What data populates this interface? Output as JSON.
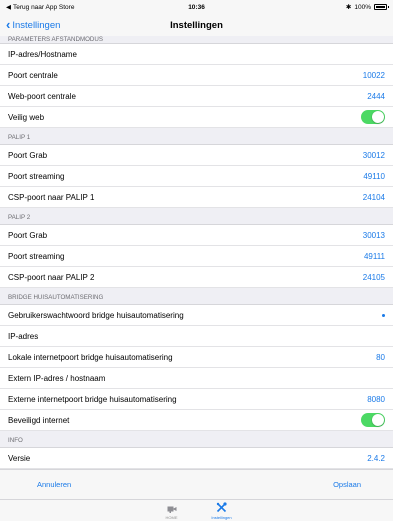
{
  "status_bar": {
    "back_app": "Terug naar App Store",
    "time": "10:36",
    "battery": "100%"
  },
  "nav": {
    "back_label": "Instellingen",
    "title": "Instellingen"
  },
  "sections": {
    "remote": {
      "header": "PARAMETERS AFSTANDMODUS",
      "ip_label": "IP-adres/Hostname",
      "port_label": "Poort centrale",
      "port_value": "10022",
      "webport_label": "Web-poort centrale",
      "webport_value": "2444",
      "secure_label": "Veilig web"
    },
    "palip1": {
      "header": "PALIP 1",
      "grab_label": "Poort Grab",
      "grab_value": "30012",
      "stream_label": "Poort streaming",
      "stream_value": "49110",
      "csp_label": "CSP-poort naar PALIP 1",
      "csp_value": "24104"
    },
    "palip2": {
      "header": "PALIP 2",
      "grab_label": "Poort Grab",
      "grab_value": "30013",
      "stream_label": "Poort streaming",
      "stream_value": "49111",
      "csp_label": "CSP-poort naar PALIP 2",
      "csp_value": "24105"
    },
    "bridge": {
      "header": "BRIDGE HUISAUTOMATISERING",
      "password_label": "Gebruikerswachtwoord bridge huisautomatisering",
      "ip_label": "IP-adres",
      "localport_label": "Lokale internetpoort bridge huisautomatisering",
      "localport_value": "80",
      "extip_label": "Extern IP-adres / hostnaam",
      "extport_label": "Externe internetpoort bridge huisautomatisering",
      "extport_value": "8080",
      "secure_label": "Beveiligd internet"
    },
    "info": {
      "header": "INFO",
      "version_label": "Versie",
      "version_value": "2.4.2"
    }
  },
  "actions": {
    "cancel": "Annuleren",
    "save": "Opslaan"
  },
  "tabs": [
    {
      "label": "HOME",
      "icon": "camera-icon"
    },
    {
      "label": "Instellingen",
      "icon": "tools-icon"
    }
  ],
  "colors": {
    "accent": "#1a7ae8",
    "toggle_on": "#4cd964"
  }
}
